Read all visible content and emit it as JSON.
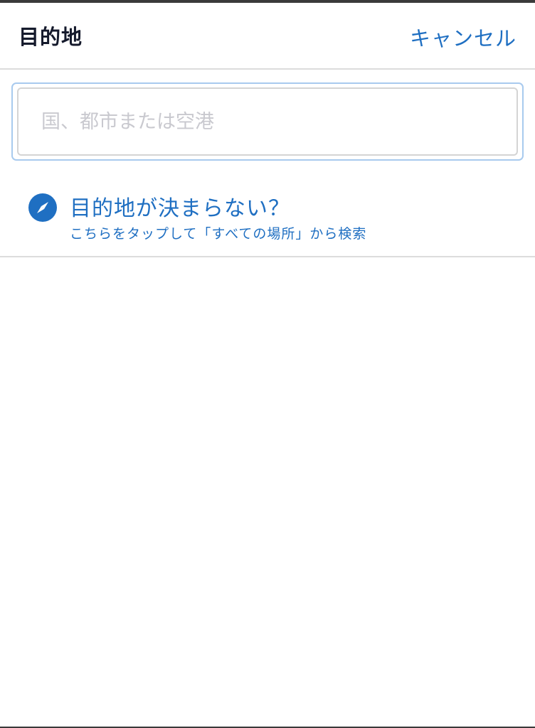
{
  "header": {
    "title": "目的地",
    "cancel_label": "キャンセル"
  },
  "search": {
    "value": "",
    "placeholder": "国、都市または空港"
  },
  "explore": {
    "icon": "compass-icon",
    "title": "目的地が決まらない？",
    "subtitle": "こちらをタップして「すべての場所」から検索"
  },
  "colors": {
    "accent": "#1f6fc2",
    "title_text": "#151a2c",
    "divider": "#dcdcdc",
    "placeholder": "#c9c9cf"
  }
}
